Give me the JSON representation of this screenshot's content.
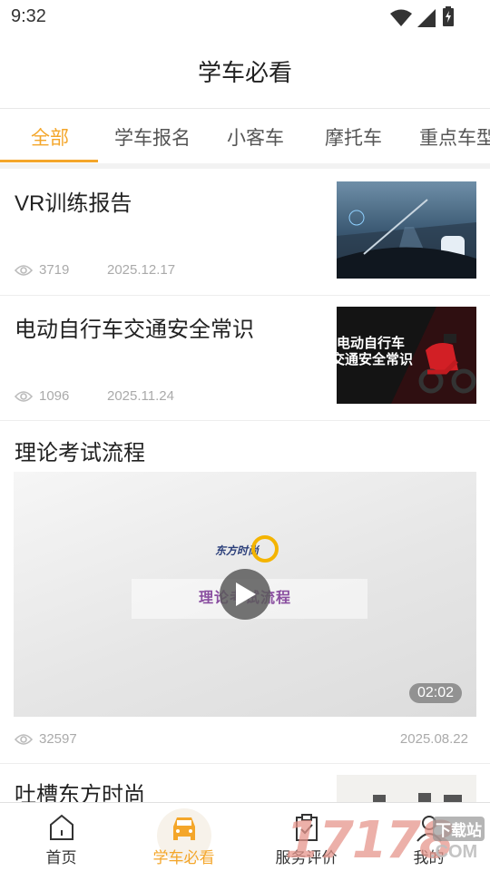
{
  "status_bar": {
    "time": "9:32"
  },
  "header": {
    "title": "学车必看"
  },
  "tabs": [
    {
      "label": "全部",
      "active": true
    },
    {
      "label": "学车报名",
      "active": false
    },
    {
      "label": "小客车",
      "active": false
    },
    {
      "label": "摩托车",
      "active": false
    },
    {
      "label": "重点车型",
      "active": false
    }
  ],
  "articles": [
    {
      "title": "VR训练报告",
      "views": "3719",
      "date": "2025.12.17"
    },
    {
      "title": "电动自行车交通安全常识",
      "views": "1096",
      "date": "2025.11.24",
      "thumb_text_line1": "电动自行车",
      "thumb_text_line2": "交通安全常识"
    },
    {
      "title": "理论考试流程",
      "views": "32597",
      "date": "2025.08.22",
      "video_logo": "东方时尚",
      "video_title": "理论考试流程",
      "duration": "02:02"
    },
    {
      "title": "吐槽东方时尚"
    }
  ],
  "bottom_nav": [
    {
      "label": "首页",
      "icon": "home-icon",
      "active": false
    },
    {
      "label": "学车必看",
      "icon": "car-icon",
      "active": true
    },
    {
      "label": "服务评价",
      "icon": "clipboard-icon",
      "active": false
    },
    {
      "label": "我的",
      "icon": "profile-icon",
      "active": false
    }
  ],
  "watermark": {
    "digits": "17178",
    "text": "下载站",
    "suffix": ".COM"
  },
  "colors": {
    "accent": "#f4a62a",
    "text": "#222222",
    "meta": "#aaaaaa",
    "divider": "#ededed"
  }
}
